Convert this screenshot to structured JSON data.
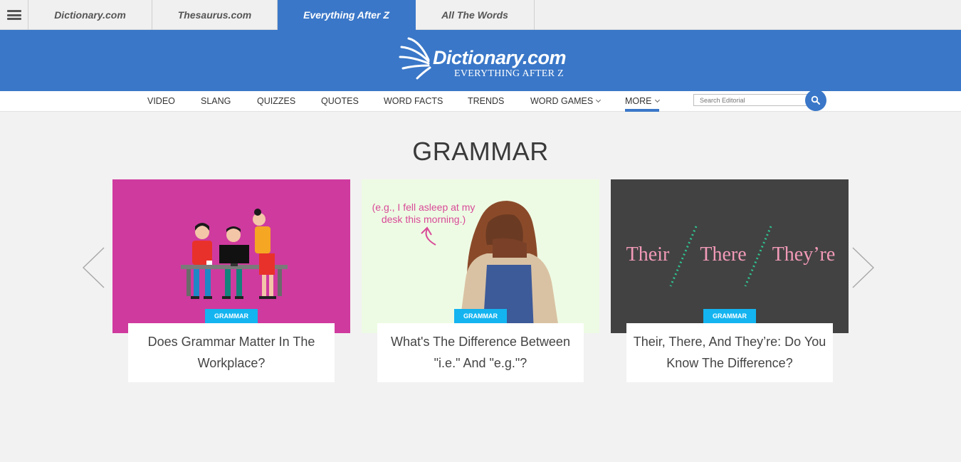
{
  "top_tabs": [
    {
      "label": "Dictionary.com"
    },
    {
      "label": "Thesaurus.com"
    },
    {
      "label": "Everything After Z"
    },
    {
      "label": "All The Words"
    }
  ],
  "logo": {
    "name": "Dictionary.com",
    "tagline": "EVERYTHING AFTER Z"
  },
  "nav": {
    "items": [
      {
        "label": "VIDEO"
      },
      {
        "label": "SLANG"
      },
      {
        "label": "QUIZZES"
      },
      {
        "label": "QUOTES"
      },
      {
        "label": "WORD FACTS"
      },
      {
        "label": "TRENDS"
      },
      {
        "label": "WORD GAMES"
      },
      {
        "label": "MORE"
      }
    ],
    "search_placeholder": "Search Editorial"
  },
  "page": {
    "title": "GRAMMAR"
  },
  "cards": [
    {
      "badge": "GRAMMAR",
      "title": "Does Grammar Matter In The Workplace?"
    },
    {
      "badge": "GRAMMAR",
      "title": "What's The Difference Between \"i.e.\" And \"e.g.\"?",
      "image_text": [
        "(e.g., I fell asleep at my",
        "desk this morning.)"
      ]
    },
    {
      "badge": "GRAMMAR",
      "title": "Their, There, And They’re: Do You Know The Difference?",
      "image_words": [
        "Their",
        "There",
        "They’re"
      ]
    }
  ],
  "colors": {
    "brand_blue": "#3a77c8",
    "badge_blue": "#13b4f0",
    "card1_bg": "#cf3a9e",
    "card2_bg": "#eefbe4",
    "card3_bg": "#424242"
  }
}
